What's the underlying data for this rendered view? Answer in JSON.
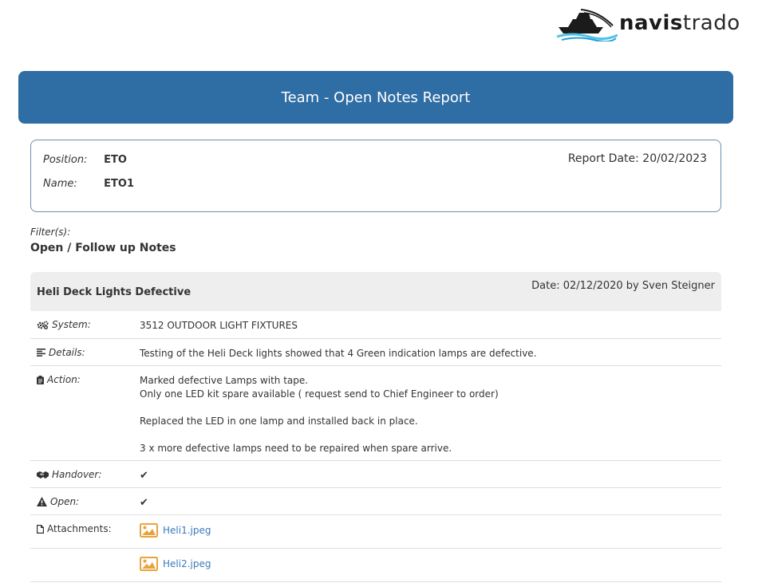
{
  "logo": {
    "bold": "navis",
    "light": "trado"
  },
  "banner": {
    "title": "Team - Open Notes Report"
  },
  "info": {
    "position_label": "Position:",
    "position_value": "ETO",
    "name_label": "Name:",
    "name_value": "ETO1",
    "report_date": "Report Date: 20/02/2023"
  },
  "filters": {
    "label": "Filter(s):",
    "value": "Open / Follow up Notes"
  },
  "note": {
    "title": "Heli Deck Lights Defective",
    "date": "Date: 02/12/2020 by Sven Steigner",
    "system_label": "System:",
    "system_icon": "gears-icon",
    "system_value": "3512 OUTDOOR LIGHT FIXTURES",
    "details_label": "Details:",
    "details_icon": "align-left-icon",
    "details_value": "Testing of the Heli Deck lights showed that 4 Green indication lamps are defective.",
    "action_label": "Action:",
    "action_icon": "clipboard-icon",
    "action_lines": [
      "Marked defective Lamps with tape.",
      "Only one LED kit spare available ( request send to Chief Engineer to order)",
      "",
      "Replaced the LED in one lamp and installed back in place.",
      "",
      "3 x more defective lamps need to be repaired when spare arrive."
    ],
    "handover_label": "Handover:",
    "handover_icon": "handshake-icon",
    "handover_value": "✔",
    "open_label": "Open:",
    "open_icon": "warning-icon",
    "open_value": "✔",
    "attachments_label": "Attachments:",
    "attachments_icon": "file-icon",
    "attachments": [
      {
        "name": "Heli1.jpeg",
        "icon": "image-icon"
      },
      {
        "name": "Heli2.jpeg",
        "icon": "image-icon"
      }
    ]
  },
  "colors": {
    "banner": "#2f6da5",
    "link": "#3a7bbf",
    "image_icon": "#e8a33d",
    "header_bg": "#eeeeee"
  }
}
